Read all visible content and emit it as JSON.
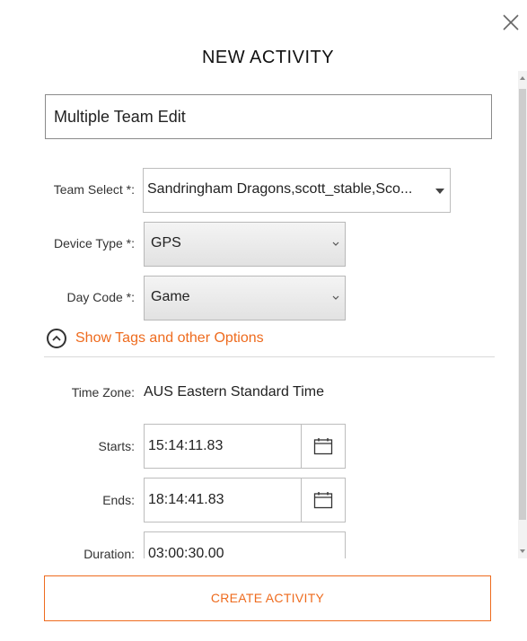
{
  "dialog": {
    "title": "NEW ACTIVITY",
    "activity_name": "Multiple Team Edit",
    "create_label": "CREATE ACTIVITY"
  },
  "form": {
    "team_select": {
      "label": "Team Select *:",
      "value": "Sandringham Dragons,scott_stable,Sco..."
    },
    "device_type": {
      "label": "Device Type *:",
      "value": "GPS"
    },
    "day_code": {
      "label": "Day Code *:",
      "value": "Game"
    },
    "show_tags_label": "Show Tags and other Options",
    "time_zone": {
      "label": "Time Zone:",
      "value": "AUS Eastern Standard Time"
    },
    "starts": {
      "label": "Starts:",
      "value": "15:14:11.83"
    },
    "ends": {
      "label": "Ends:",
      "value": "18:14:41.83"
    },
    "duration": {
      "label": "Duration:",
      "value": "03:00:30.00"
    }
  },
  "colors": {
    "accent": "#ee6b1e",
    "border": "#bdbdbd"
  },
  "icons": [
    "close-icon",
    "caret-down-icon",
    "chevron-down-icon",
    "chevron-up-icon",
    "calendar-icon"
  ]
}
